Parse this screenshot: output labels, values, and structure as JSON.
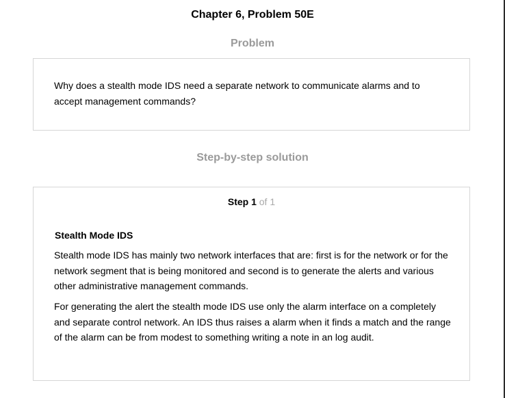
{
  "header": {
    "title": "Chapter 6, Problem 50E"
  },
  "problem": {
    "heading": "Problem",
    "text": "Why does a stealth mode IDS need a separate network to communicate alarms and to accept management commands?"
  },
  "solution": {
    "heading": "Step-by-step solution",
    "step": {
      "label": "Step 1",
      "of": "of 1"
    },
    "subheading": "Stealth Mode IDS",
    "paragraphs": [
      "Stealth mode IDS has mainly two network interfaces that are: first is for the network or for the network segment that is being monitored and second is to generate the alerts and various other administrative management commands.",
      "For generating the alert the stealth mode IDS use only the alarm interface on a completely and separate control network. An IDS thus raises a alarm when it finds a match and the range of the alarm can be from modest to something writing a note in an log audit."
    ]
  }
}
